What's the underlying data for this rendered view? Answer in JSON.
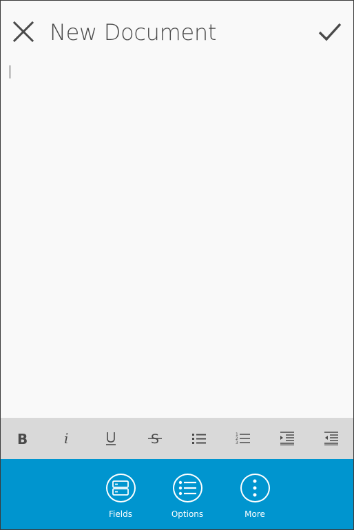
{
  "header": {
    "title": "New Document",
    "close_icon": "close-icon",
    "confirm_icon": "checkmark-icon"
  },
  "editor": {
    "content": ""
  },
  "format_bar": {
    "buttons": [
      {
        "name": "bold",
        "icon": "bold-icon"
      },
      {
        "name": "italic",
        "icon": "italic-icon"
      },
      {
        "name": "underline",
        "icon": "underline-icon"
      },
      {
        "name": "strikethrough",
        "icon": "strikethrough-icon"
      },
      {
        "name": "bulleted-list",
        "icon": "bulleted-list-icon"
      },
      {
        "name": "numbered-list",
        "icon": "numbered-list-icon"
      },
      {
        "name": "increase-indent",
        "icon": "increase-indent-icon"
      },
      {
        "name": "decrease-indent",
        "icon": "decrease-indent-icon"
      }
    ]
  },
  "appbar": {
    "fields_label": "Fields",
    "options_label": "Options",
    "more_label": "More"
  },
  "colors": {
    "appbar_background": "#0095cf",
    "format_bar_background": "#d9d9d9",
    "page_background": "#f9f9f9",
    "icon_foreground": "#4a4a4a"
  }
}
